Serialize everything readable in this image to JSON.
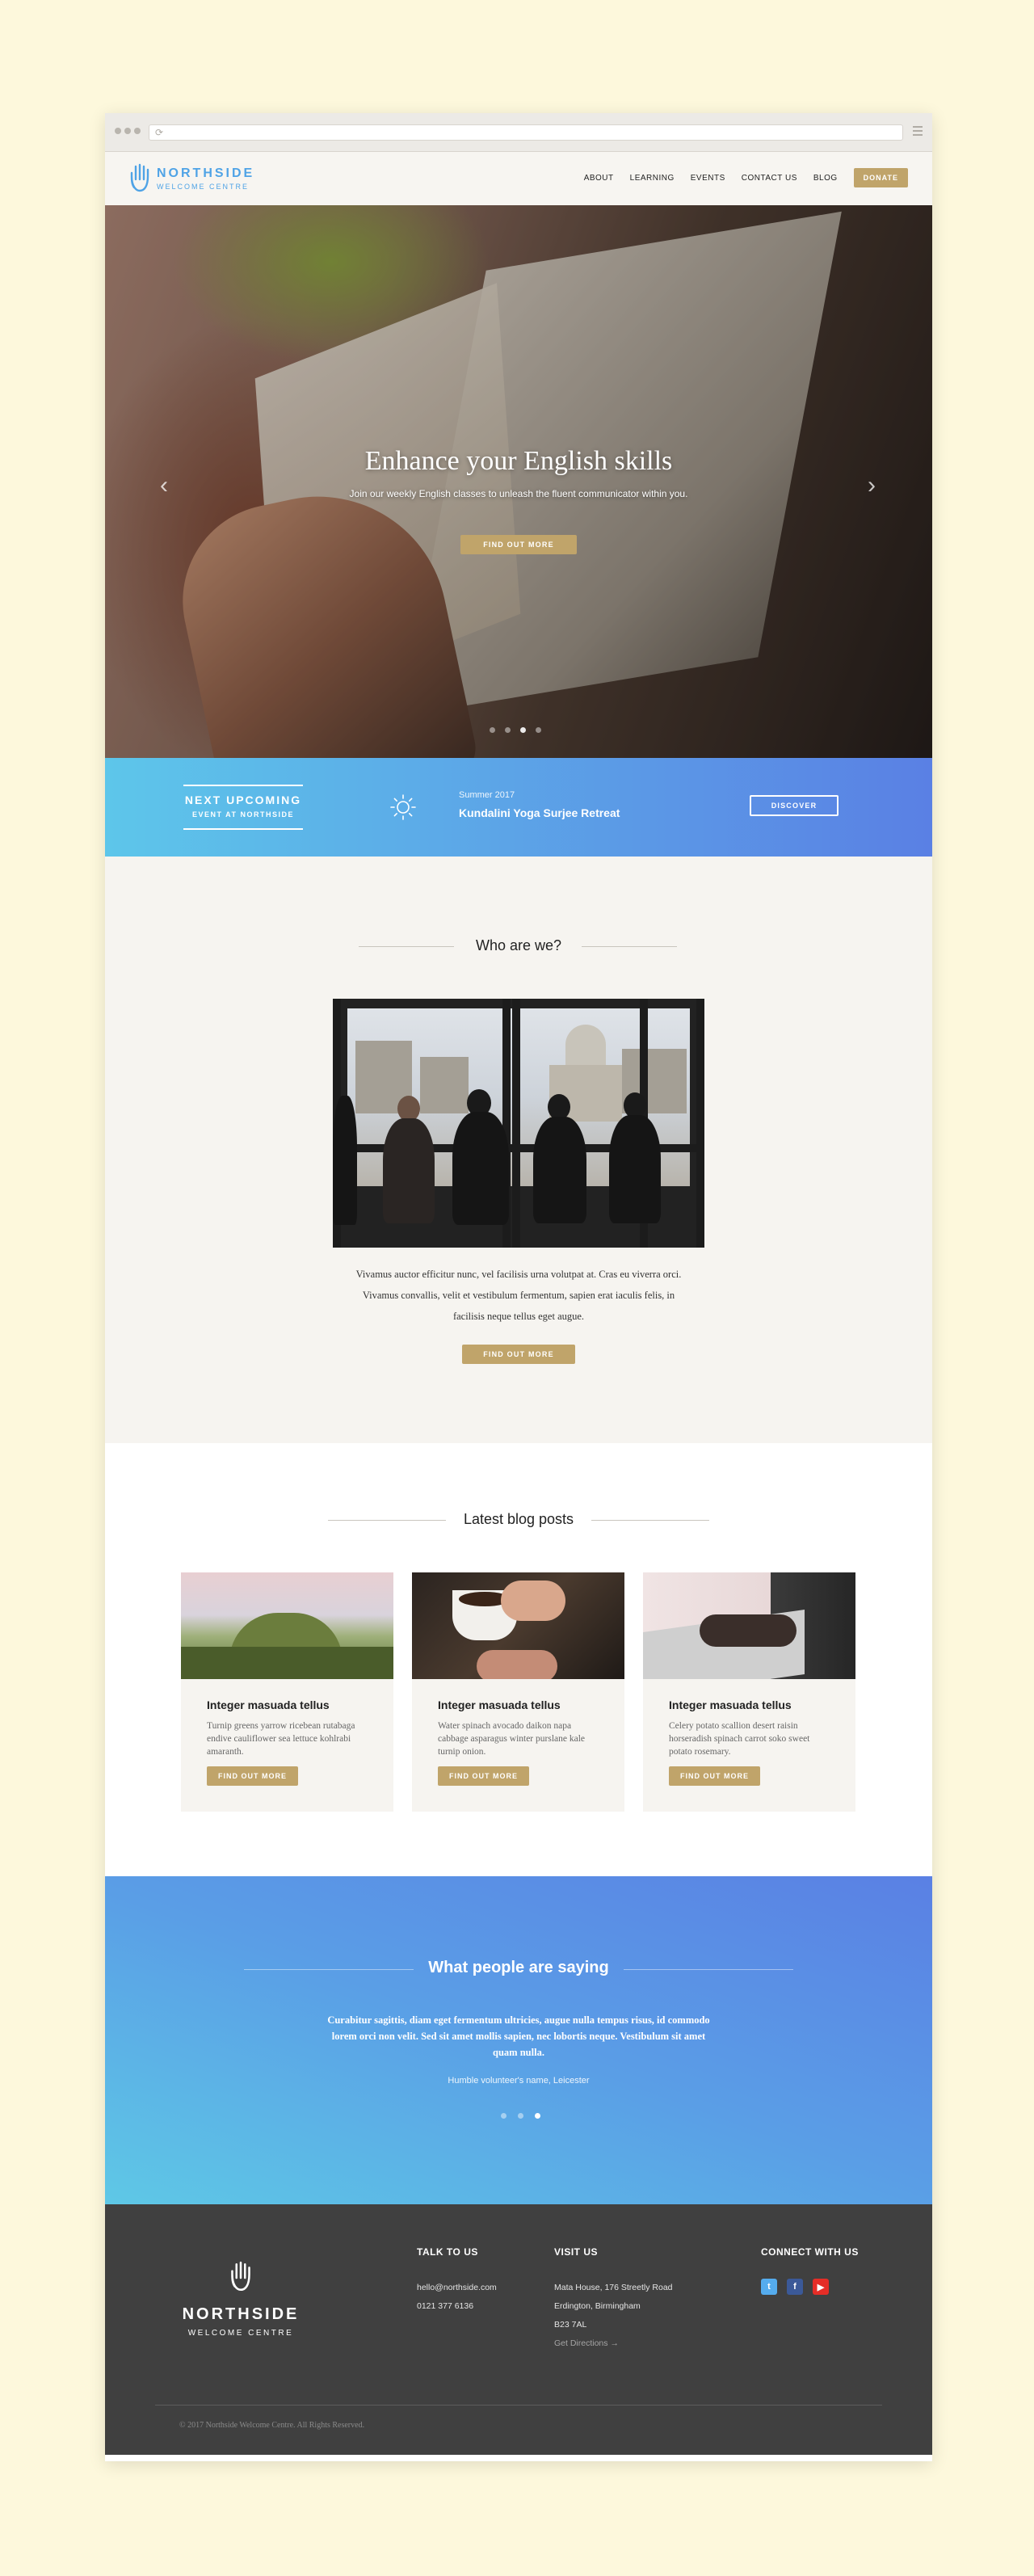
{
  "nav": {
    "logo_name": "NORTHSIDE",
    "logo_tagline": "WELCOME CENTRE",
    "items": [
      "ABOUT",
      "LEARNING",
      "EVENTS",
      "CONTACT US",
      "BLOG"
    ],
    "donate": "DONATE"
  },
  "hero": {
    "title": "Enhance your English skills",
    "subtitle": "Join our weekly English classes to unleash the fluent communicator within you.",
    "button": "FIND OUT MORE",
    "slides": 4,
    "active_slide": 3
  },
  "event": {
    "label_line1": "NEXT UPCOMING",
    "label_line2": "EVENT AT NORTHSIDE",
    "season": "Summer 2017",
    "name": "Kundalini Yoga Surjee Retreat",
    "button": "DISCOVER"
  },
  "who": {
    "title": "Who are we?",
    "text": "Vivamus auctor efficitur nunc, vel facilisis urna volutpat at. Cras eu viverra orci. Vivamus convallis, velit et vestibulum fermentum, sapien erat iaculis felis, in facilisis neque tellus eget augue.",
    "button": "FIND OUT MORE"
  },
  "blog": {
    "title": "Latest blog posts",
    "posts": [
      {
        "title": "Integer masuada tellus",
        "text": "Turnip greens yarrow ricebean rutabaga endive cauliflower sea lettuce kohlrabi amaranth.",
        "button": "FIND OUT MORE"
      },
      {
        "title": "Integer masuada tellus",
        "text": "Water spinach avocado daikon napa cabbage asparagus winter purslane kale turnip onion.",
        "button": "FIND OUT MORE"
      },
      {
        "title": "Integer masuada tellus",
        "text": "Celery potato scallion desert raisin horseradish spinach carrot soko sweet potato rosemary.",
        "button": "FIND OUT MORE"
      }
    ]
  },
  "testimonial": {
    "title": "What people are saying",
    "quote": "Curabitur sagittis, diam eget fermentum ultricies, augue nulla tempus risus, id commodo lorem orci non velit. Sed sit amet mollis sapien, nec lobortis neque. Vestibulum sit amet quam nulla.",
    "author": "Humble volunteer's name, Leicester",
    "slides": 3,
    "active_slide": 3
  },
  "footer": {
    "logo_name": "NORTHSIDE",
    "logo_tagline": "WELCOME CENTRE",
    "talk_title": "TALK TO US",
    "email": "hello@northside.com",
    "phone": "0121 377 6136",
    "visit_title": "VISIT US",
    "address1": "Mata House, 176 Streetly Road",
    "address2": "Erdington, Birmingham",
    "address3": "B23 7AL",
    "directions": "Get Directions →",
    "connect_title": "CONNECT WITH US",
    "social": [
      {
        "icon": "twitter-icon",
        "glyph": "t",
        "color": "#55acee"
      },
      {
        "icon": "facebook-icon",
        "glyph": "f",
        "color": "#3b5998"
      },
      {
        "icon": "youtube-icon",
        "glyph": "▶",
        "color": "#e52d27"
      }
    ],
    "copyright": "© 2017 Northside Welcome Centre. All Rights Reserved."
  },
  "colors": {
    "accent_gold": "#c0a46a",
    "brand_blue": "#4fa3e6",
    "gradient_start": "#5dc6ea",
    "gradient_end": "#5a80e4",
    "footer_bg": "#404040"
  }
}
